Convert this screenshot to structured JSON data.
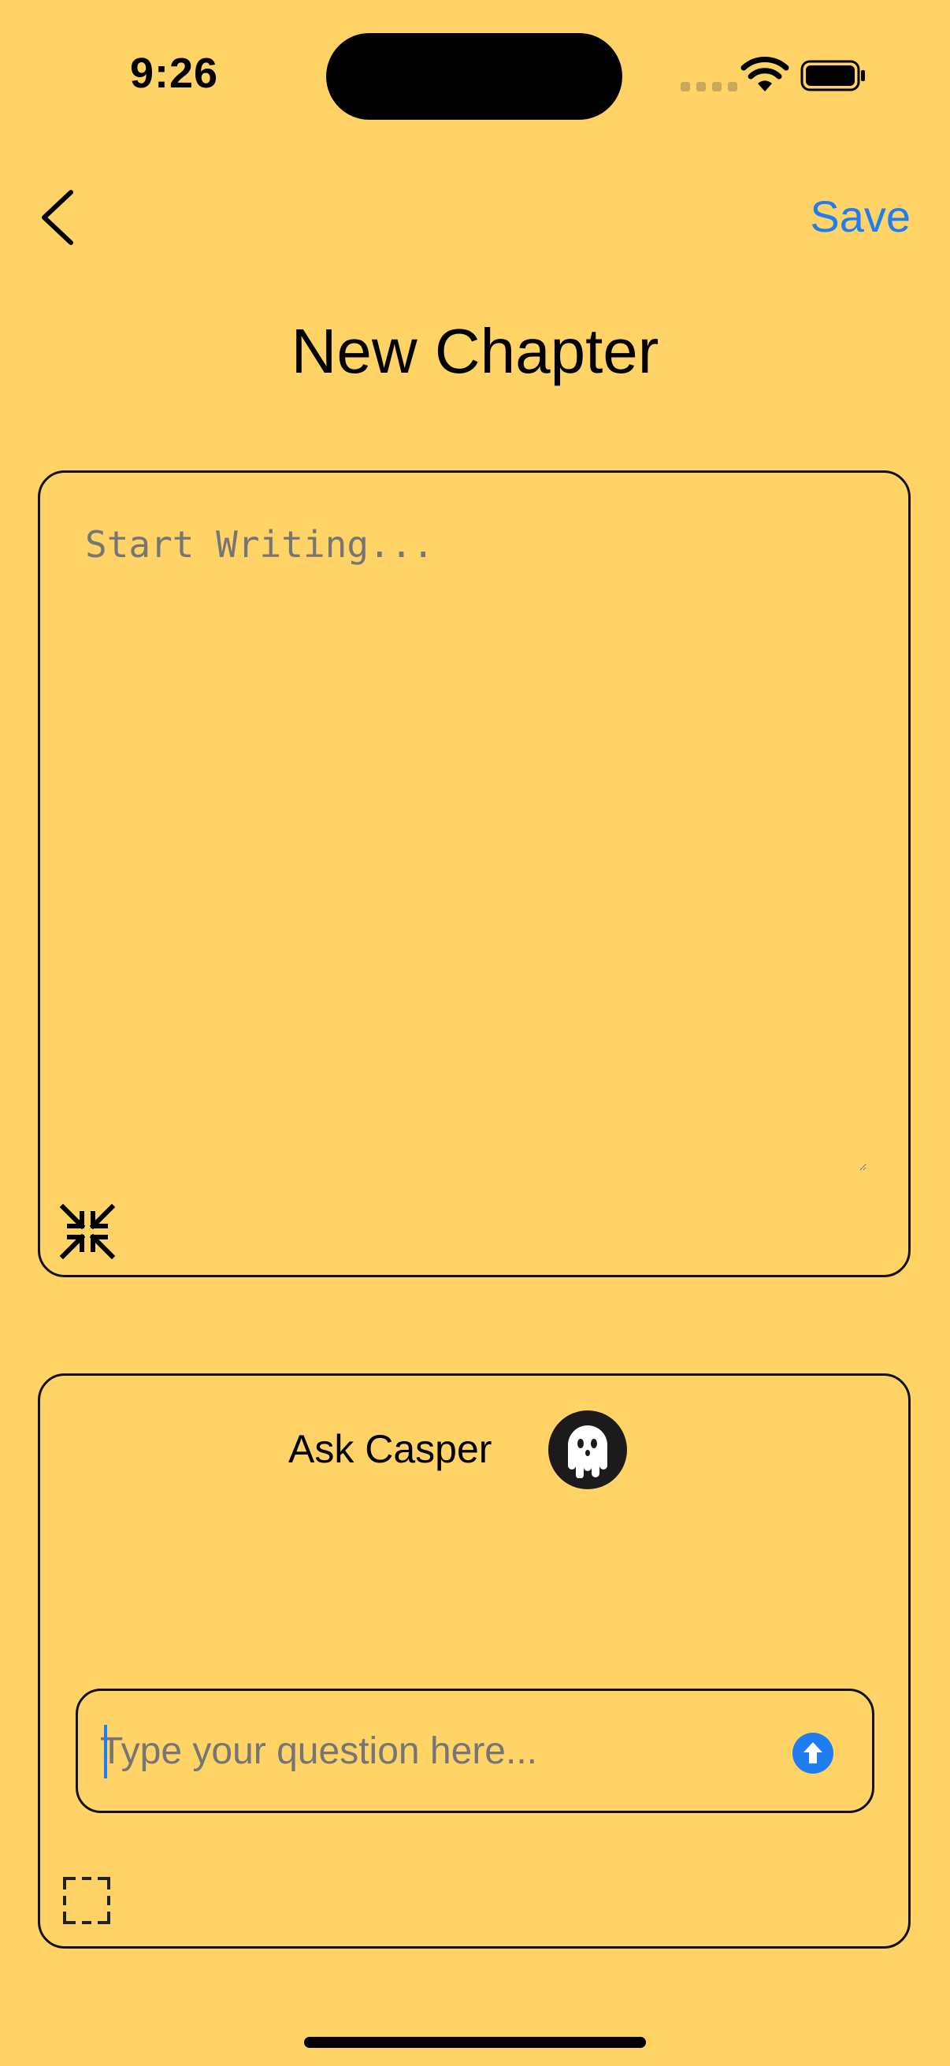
{
  "status_bar": {
    "time": "9:26"
  },
  "nav": {
    "save_label": "Save"
  },
  "page": {
    "title": "New Chapter"
  },
  "editor": {
    "placeholder": "Start Writing..."
  },
  "ask": {
    "title": "Ask Casper",
    "placeholder": "Type your question here..."
  },
  "icons": {
    "back": "chevron-left-icon",
    "collapse": "collapse-arrows-icon",
    "ghost": "ghost-icon",
    "send": "arrow-up-circle-icon",
    "expand": "expand-frame-icon"
  },
  "colors": {
    "background": "#FFD366",
    "accent": "#1E7DF0",
    "text": "#000000"
  }
}
